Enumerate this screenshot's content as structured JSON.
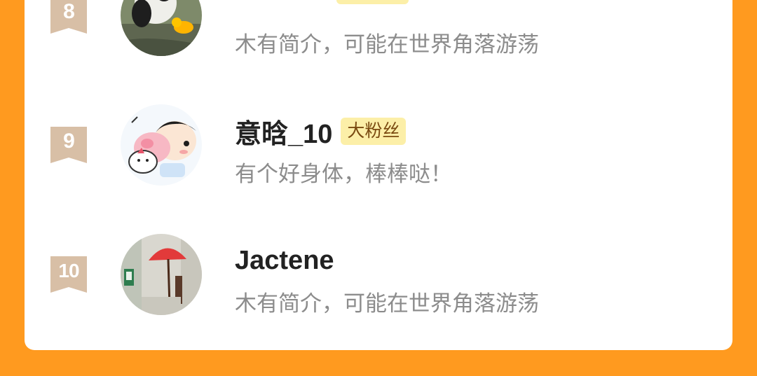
{
  "colors": {
    "background": "#FF9A1F",
    "card": "#FFFFFF",
    "rank_ribbon": "#D8BFA6",
    "badge_bg": "#FCEFA8",
    "name": "#222222",
    "bio": "#8C8C8C"
  },
  "fans": [
    {
      "rank": "8",
      "name": "",
      "badge": "",
      "bio": "木有简介，可能在世界角落游荡",
      "avatar": "panda-avatar"
    },
    {
      "rank": "9",
      "name": "意晗_10",
      "badge": "大粉丝",
      "bio": "有个好身体，棒棒哒！",
      "avatar": "cartoon-avatar"
    },
    {
      "rank": "10",
      "name": "Jactene",
      "badge": "",
      "bio": "木有简介，可能在世界角落游荡",
      "avatar": "umbrella-photo-avatar"
    }
  ]
}
